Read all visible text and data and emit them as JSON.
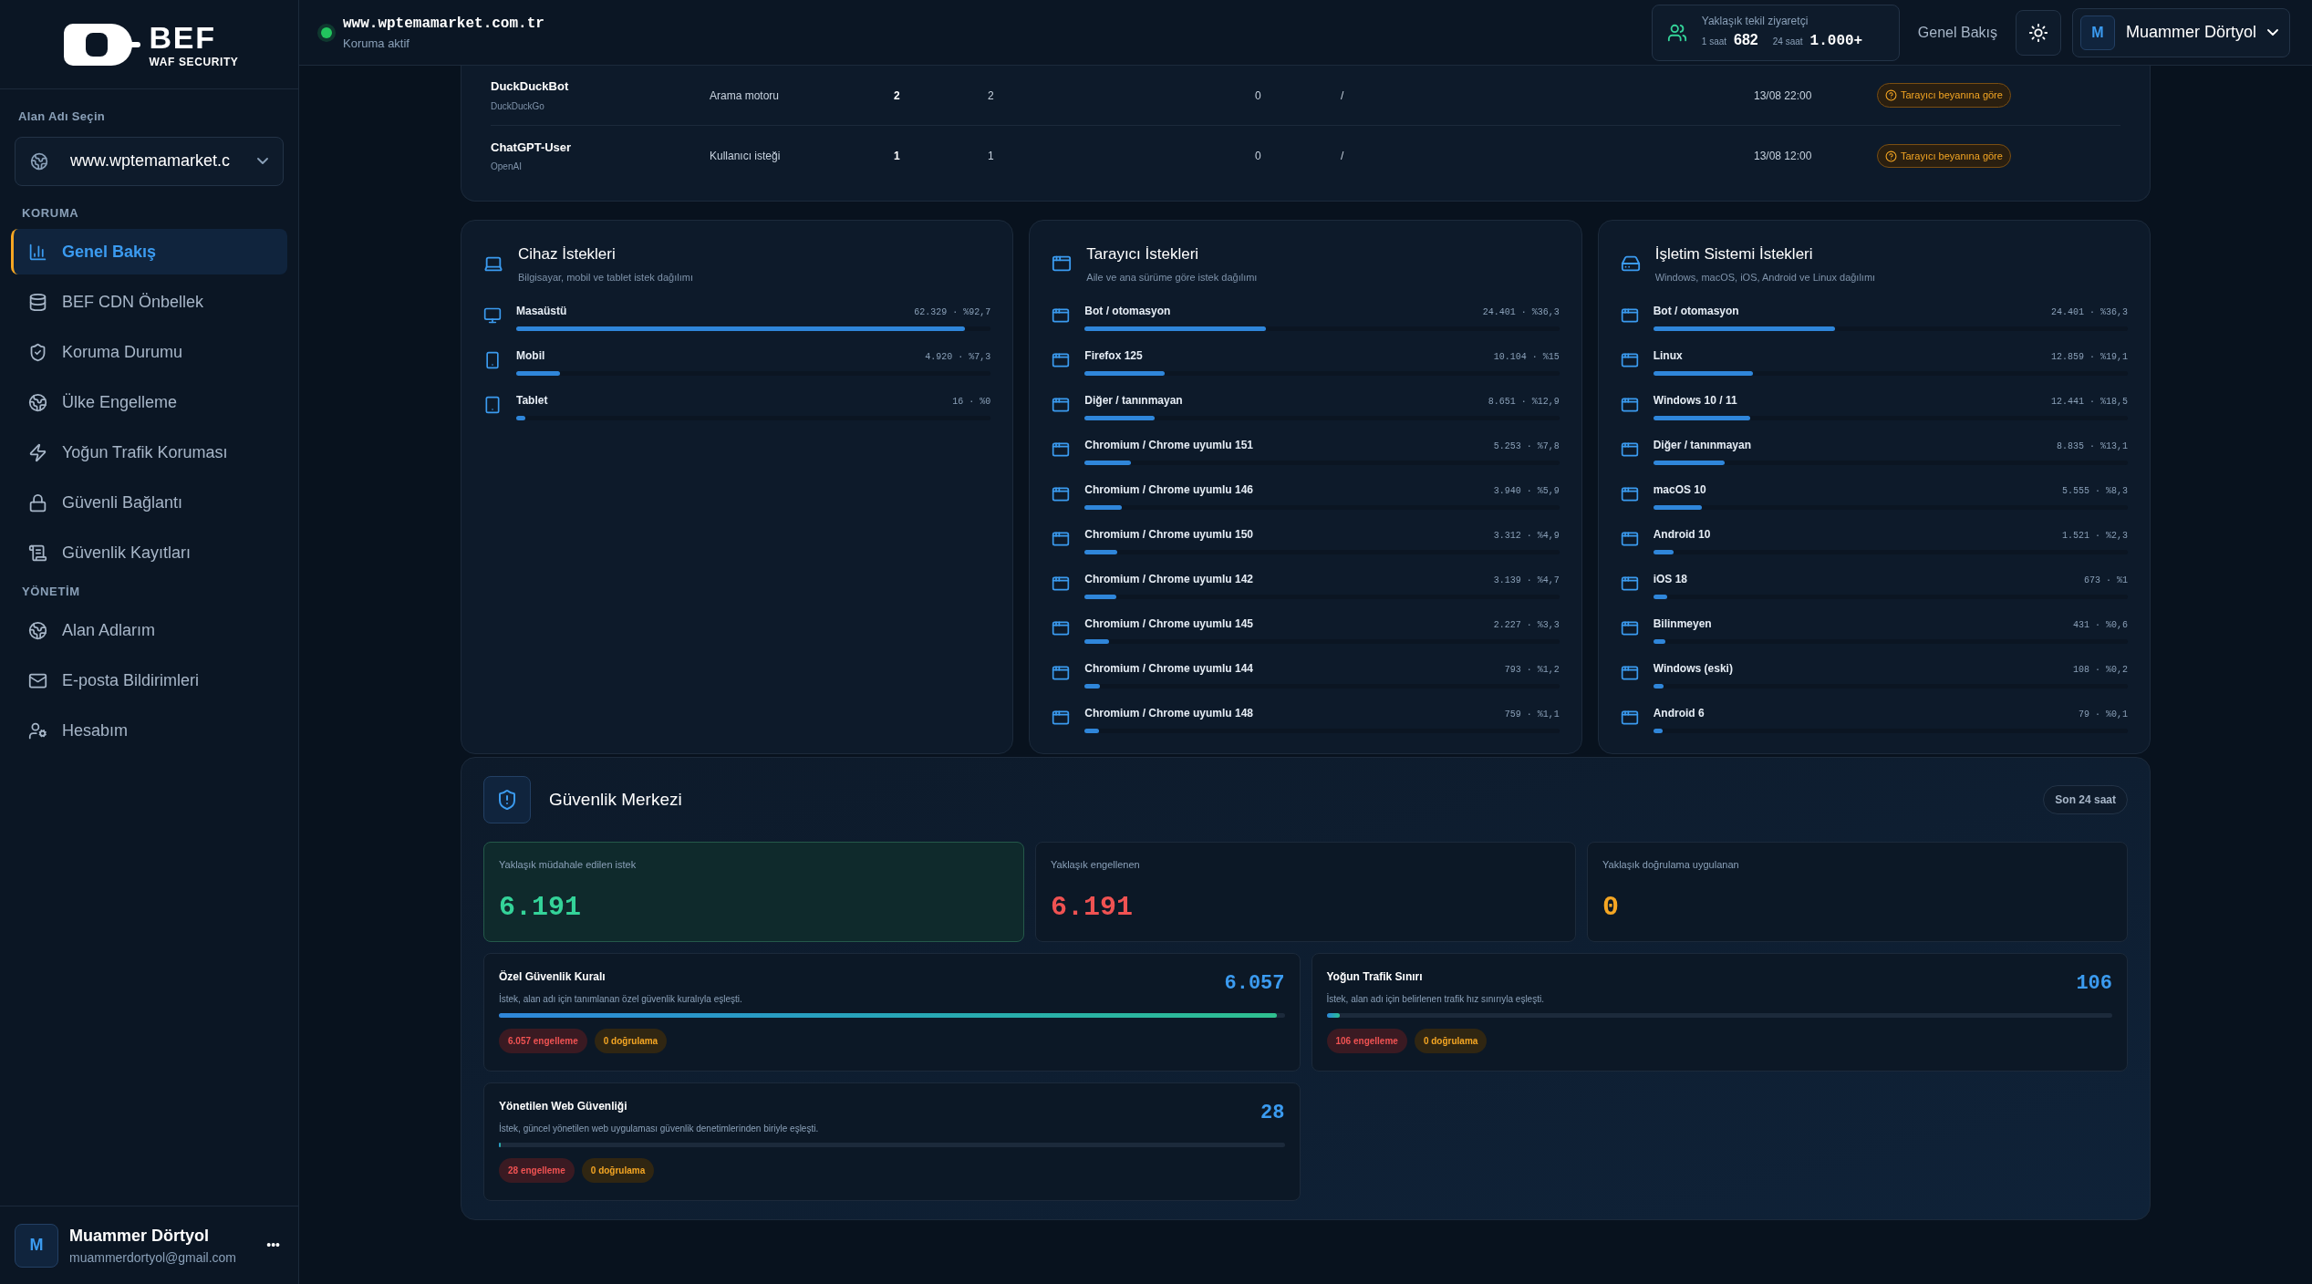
{
  "sidebar": {
    "logo": {
      "name": "BEF",
      "tagline": "WAF SECURITY"
    },
    "domain_label": "Alan Adı Seçin",
    "domain_value": "www.wptemamarket.c",
    "sections": [
      {
        "title": "KORUMA",
        "items": [
          {
            "label": "Genel Bakış",
            "selected": true
          },
          {
            "label": "BEF CDN Önbellek",
            "selected": false
          },
          {
            "label": "Koruma Durumu",
            "selected": false
          },
          {
            "label": "Ülke Engelleme",
            "selected": false
          },
          {
            "label": "Yoğun Trafik Koruması",
            "selected": false
          },
          {
            "label": "Güvenli Bağlantı",
            "selected": false
          },
          {
            "label": "Güvenlik Kayıtları",
            "selected": false
          }
        ]
      },
      {
        "title": "YÖNETİM",
        "items": [
          {
            "label": "Alan Adlarım",
            "selected": false
          },
          {
            "label": "E-posta Bildirimleri",
            "selected": false
          },
          {
            "label": "Hesabım",
            "selected": false
          }
        ]
      }
    ],
    "user": {
      "initial": "M",
      "name": "Muammer Dörtyol",
      "email": "muammerdortyol@gmail.com",
      "menu": "•••"
    }
  },
  "header": {
    "site": "www.wptemamarket.com.tr",
    "status": "Koruma aktif",
    "visitors": {
      "title": "Yaklaşık tekil ziyaretçi",
      "h1_label": "1 saat",
      "h1_value": "682",
      "h24_label": "24 saat",
      "h24_value": "1.000+"
    },
    "nav_link": "Genel Bakış",
    "user": {
      "initial": "M",
      "name": "Muammer Dörtyol"
    }
  },
  "bots_table": {
    "rows": [
      {
        "name": "DuckDuckBot",
        "vendor": "DuckDuckGo",
        "type": "Arama motoru",
        "column_4": "2",
        "column_5": "2",
        "column_6": "0",
        "column_7": "/",
        "time": "13/08 22:00",
        "badge": "Tarayıcı beyanına göre"
      },
      {
        "name": "ChatGPT-User",
        "vendor": "OpenAI",
        "type": "Kullanıcı isteği",
        "column_4": "1",
        "column_5": "1",
        "column_6": "0",
        "column_7": "/",
        "time": "13/08 12:00",
        "badge": "Tarayıcı beyanına göre"
      }
    ]
  },
  "distribution_cards": [
    {
      "title": "Cihaz İstekleri",
      "subtitle": "Bilgisayar, mobil ve tablet istek dağılımı",
      "items": [
        {
          "label": "Masaüstü",
          "value": "62.329 · %92,7",
          "level": 0.927,
          "kind": "desktop"
        },
        {
          "label": "Mobil",
          "value": "4.920 · %7,3",
          "level": 0.073,
          "kind": "mobile"
        },
        {
          "label": "Tablet",
          "value": "16 · %0",
          "level": 0,
          "kind": "tablet"
        }
      ]
    },
    {
      "title": "Tarayıcı İstekleri",
      "subtitle": "Aile ve ana sürüme göre istek dağılımı",
      "items": [
        {
          "label": "Bot / otomasyon",
          "value": "24.401 · %36,3",
          "level": 0.363,
          "kind": "browser"
        },
        {
          "label": "Firefox 125",
          "value": "10.104 · %15",
          "level": 0.15,
          "kind": "browser"
        },
        {
          "label": "Diğer / tanınmayan",
          "value": "8.651 · %12,9",
          "level": 0.129,
          "kind": "browser"
        },
        {
          "label": "Chromium / Chrome uyumlu 151",
          "value": "5.253 · %7,8",
          "level": 0.078,
          "kind": "browser"
        },
        {
          "label": "Chromium / Chrome uyumlu 146",
          "value": "3.940 · %5,9",
          "level": 0.059,
          "kind": "browser"
        },
        {
          "label": "Chromium / Chrome uyumlu 150",
          "value": "3.312 · %4,9",
          "level": 0.049,
          "kind": "browser"
        },
        {
          "label": "Chromium / Chrome uyumlu 142",
          "value": "3.139 · %4,7",
          "level": 0.047,
          "kind": "browser"
        },
        {
          "label": "Chromium / Chrome uyumlu 145",
          "value": "2.227 · %3,3",
          "level": 0.033,
          "kind": "browser"
        },
        {
          "label": "Chromium / Chrome uyumlu 144",
          "value": "793 · %1,2",
          "level": 0.012,
          "kind": "browser"
        },
        {
          "label": "Chromium / Chrome uyumlu 148",
          "value": "759 · %1,1",
          "level": 0.011,
          "kind": "browser"
        }
      ]
    },
    {
      "title": "İşletim Sistemi İstekleri",
      "subtitle": "Windows, macOS, iOS, Android ve Linux dağılımı",
      "items": [
        {
          "label": "Bot / otomasyon",
          "value": "24.401 · %36,3",
          "level": 0.363,
          "kind": "browser"
        },
        {
          "label": "Linux",
          "value": "12.859 · %19,1",
          "level": 0.191,
          "kind": "browser"
        },
        {
          "label": "Windows 10 / 11",
          "value": "12.441 · %18,5",
          "level": 0.185,
          "kind": "browser"
        },
        {
          "label": "Diğer / tanınmayan",
          "value": "8.835 · %13,1",
          "level": 0.131,
          "kind": "browser"
        },
        {
          "label": "macOS 10",
          "value": "5.555 · %8,3",
          "level": 0.083,
          "kind": "browser"
        },
        {
          "label": "Android 10",
          "value": "1.521 · %2,3",
          "level": 0.023,
          "kind": "browser"
        },
        {
          "label": "iOS 18",
          "value": "673 · %1",
          "level": 0.01,
          "kind": "browser"
        },
        {
          "label": "Bilinmeyen",
          "value": "431 · %0,6",
          "level": 0.006,
          "kind": "browser"
        },
        {
          "label": "Windows (eski)",
          "value": "108 · %0,2",
          "level": 0.002,
          "kind": "browser"
        },
        {
          "label": "Android 6",
          "value": "79 · %0,1",
          "level": 0.001,
          "kind": "browser"
        }
      ]
    }
  ],
  "security_center": {
    "title": "Güvenlik Merkezi",
    "period": "Son 24 saat",
    "stats": [
      {
        "label": "Yaklaşık müdahale edilen istek",
        "value": "6.191",
        "color": "#34d399",
        "highlighted": true
      },
      {
        "label": "Yaklaşık engellenen",
        "value": "6.191",
        "color": "#f05252",
        "highlighted": false
      },
      {
        "label": "Yaklaşık doğrulama uygulanan",
        "value": "0",
        "color": "#f5a623",
        "highlighted": false
      }
    ],
    "rules": [
      {
        "title": "Özel Güvenlik Kuralı",
        "description": "İstek, alan adı için tanımlanan özel güvenlik kuralıyla eşleşti.",
        "count": "6.057",
        "level": 0.99,
        "blocked": "6.057 engelleme",
        "verified": "0 doğrulama"
      },
      {
        "title": "Yoğun Trafik Sınırı",
        "description": "İstek, alan adı için belirlenen trafik hız sınırıyla eşleşti.",
        "count": "106",
        "level": 0.017,
        "blocked": "106 engelleme",
        "verified": "0 doğrulama"
      },
      {
        "title": "Yönetilen Web Güvenliği",
        "description": "İstek, güncel yönetilen web uygulaması güvenlik denetimlerinden biriyle eşleşti.",
        "count": "28",
        "level": 0,
        "blocked": "28 engelleme",
        "verified": "0 doğrulama"
      }
    ]
  }
}
